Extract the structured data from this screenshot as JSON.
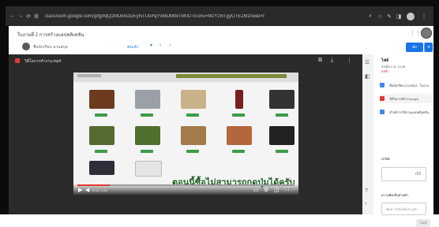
{
  "browser": {
    "back": "←",
    "forward": "→",
    "reload": "⟳",
    "url": "classroom.google.com/g/tg/NjQ2MDk5ODEyNTU0/NjYxMDMlNTM0OTEx#u=MzY1NTgyOTE2Mzcw&t=f",
    "icons": {
      "search": "search-icon",
      "star": "star-icon",
      "extensions": "extensions-icon",
      "sidepanel": "sidepanel-icon",
      "profile": "profile-icon",
      "menu": "kebab-icon"
    }
  },
  "app": {
    "title": "ใบงานที่ 2 การสร้างแอปพลิเคชัน",
    "apps_icon": "⋮⋮",
    "student_name": "ชื่อนักเรียน นามสกุล",
    "status_select": "ส่งแล้ว",
    "return_button": "ส่ง",
    "accent": "#1a73e8"
  },
  "viewer": {
    "file_title": "วิดีโอการทำงาน.mp4",
    "caption": "ตอนนี้ซื้อไม่สามารถกดปุ่มได้ครับ",
    "time": "0:15 / 1:34",
    "progress": 0.15
  },
  "panel": {
    "title": "ไฟล์",
    "date": "ส่งเมื่อ ก.พ. 15:38",
    "late": "ส่งช้า",
    "attachments": [
      {
        "label": "ชื่อนักเรียน นามสกุล - ใบงานที่ 2 การสร้าง",
        "color": "#4285f4"
      },
      {
        "label": "วิดีโอการทำงาน.mp4",
        "color": "#e53935"
      },
      {
        "label": "สไลด์การใช้งานแอปพลิเคชัน.docx",
        "color": "#4285f4"
      }
    ],
    "grade_label": "เกรด",
    "grade_value": "/10",
    "comments_label": "ความคิดเห็นส่วนตัว",
    "comment_placeholder": "เพิ่มความคิดเห็นส่วนตัว...",
    "post_label": "โพสต์"
  }
}
